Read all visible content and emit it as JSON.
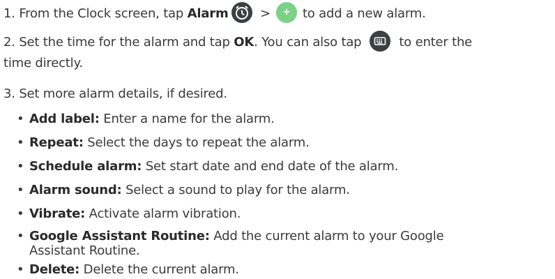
{
  "steps": [
    {
      "num": "1.",
      "text_a": "From the Clock screen, tap",
      "bold_a": "Alarm",
      "sep": ">",
      "text_b": "to add a new alarm."
    },
    {
      "num": "2.",
      "text_a": "Set the time for the alarm and tap",
      "bold_a": "OK",
      "text_b": ". You can also tap",
      "text_c": "to enter the",
      "text_d": "time directly."
    },
    {
      "num": "3.",
      "text_a": "Set more alarm details, if desired."
    }
  ],
  "details": [
    {
      "bold": "Add label:",
      "text": "Enter a name for the alarm."
    },
    {
      "bold": "Repeat:",
      "text": "Select the days to repeat the alarm."
    },
    {
      "bold": "Schedule alarm:",
      "text": "Set start date and end date of the alarm."
    },
    {
      "bold": "Alarm sound:",
      "text": "Select a sound to play for the alarm."
    },
    {
      "bold": "Vibrate:",
      "text": "Activate alarm vibration."
    },
    {
      "bold": "Google Assistant Routine:",
      "text": "Add the current alarm to your Google",
      "text_cont": "Assistant Routine."
    },
    {
      "bold": "Delete:",
      "text": "Delete the current alarm."
    }
  ],
  "icons": {
    "alarm": "alarm-clock-icon",
    "add": "plus-icon",
    "keyboard": "keyboard-icon",
    "plus_glyph": "+",
    "bullet_glyph": "•"
  },
  "colors": {
    "text": "#3a3a3a",
    "icon_dark": "#3c4043",
    "icon_green": "#7dd186"
  }
}
